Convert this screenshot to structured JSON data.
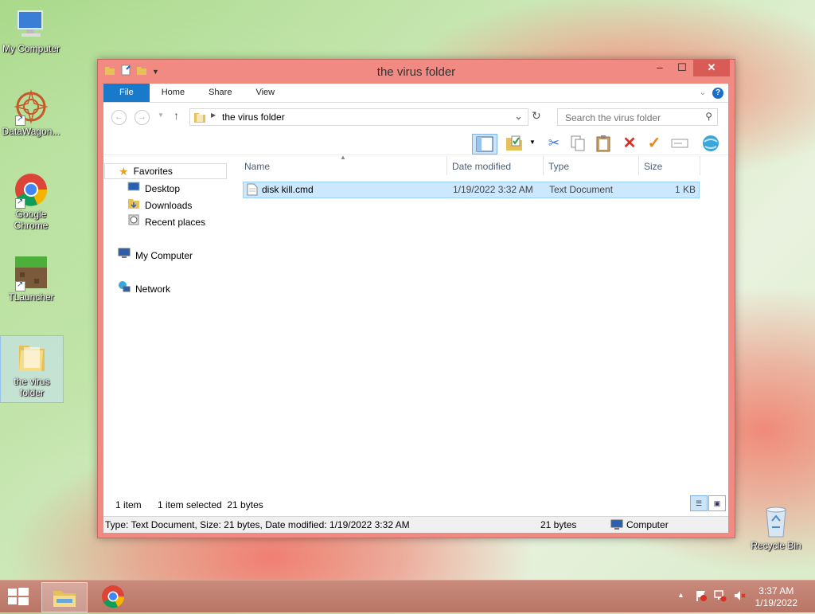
{
  "desktop": {
    "icons": [
      {
        "label": "My Computer"
      },
      {
        "label": "DataWagon..."
      },
      {
        "label": "Google Chrome"
      },
      {
        "label": "TLauncher"
      },
      {
        "label": "the virus folder"
      },
      {
        "label": "Recycle Bin"
      }
    ]
  },
  "window": {
    "title": "the virus folder",
    "controls": {
      "minimize": "–",
      "maximize": "☐",
      "close": "✕"
    },
    "ribbon_tabs": [
      "File",
      "Home",
      "Share",
      "View"
    ],
    "address": {
      "path": "the virus folder"
    },
    "search": {
      "placeholder": "Search the virus folder"
    },
    "nav": {
      "favorites": "Favorites",
      "desktop": "Desktop",
      "downloads": "Downloads",
      "recent": "Recent places",
      "computer": "My Computer",
      "network": "Network"
    },
    "columns": {
      "name": "Name",
      "date": "Date modified",
      "type": "Type",
      "size": "Size"
    },
    "files": [
      {
        "name": "disk kill.cmd",
        "date": "1/19/2022 3:32 AM",
        "type": "Text Document",
        "size": "1 KB"
      }
    ],
    "status": {
      "count": "1 item",
      "selected": "1 item selected  21 bytes",
      "details": "Type: Text Document, Size: 21 bytes, Date modified: 1/19/2022 3:32 AM",
      "bytes": "21 bytes",
      "location": "Computer"
    }
  },
  "taskbar": {
    "time": "3:37 AM",
    "date": "1/19/2022"
  }
}
